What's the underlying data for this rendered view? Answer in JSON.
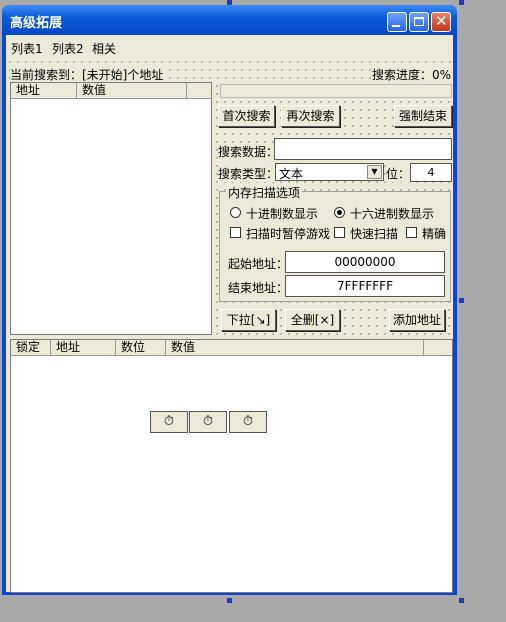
{
  "window": {
    "title": "高级拓展"
  },
  "menu": [
    "列表1",
    "列表2",
    "相关"
  ],
  "status": {
    "current": "当前搜索到：[未开始]个地址",
    "progress": "搜索进度：0%"
  },
  "top_table": {
    "columns": [
      "地址",
      "数值"
    ]
  },
  "buttons": {
    "first_search": "首次搜索",
    "next_search": "再次搜索",
    "force_end": "强制结束",
    "dropdown": "下拉[↘]",
    "delete_all": "全删[×]",
    "add_address": "添加地址"
  },
  "search": {
    "data_label": "搜索数据：",
    "data_value": "",
    "type_label": "搜索类型：",
    "type_value": "文本",
    "bits_label": "位：",
    "bits_value": "4"
  },
  "scan_options": {
    "title": "内存扫描选项",
    "decimal": "十进制数显示",
    "hex": "十六进制数显示",
    "pause": "扫描时暂停游戏",
    "fast": "快速扫描",
    "exact": "精确",
    "start_label": "起始地址：",
    "start_value": "00000000",
    "end_label": "结束地址：",
    "end_value": "7FFFFFFF"
  },
  "bottom_table": {
    "columns": [
      "锁定",
      "地址",
      "数位",
      "数值"
    ]
  },
  "icons": [
    "stopwatch-icon",
    "stopwatch-icon",
    "stopwatch-icon"
  ]
}
